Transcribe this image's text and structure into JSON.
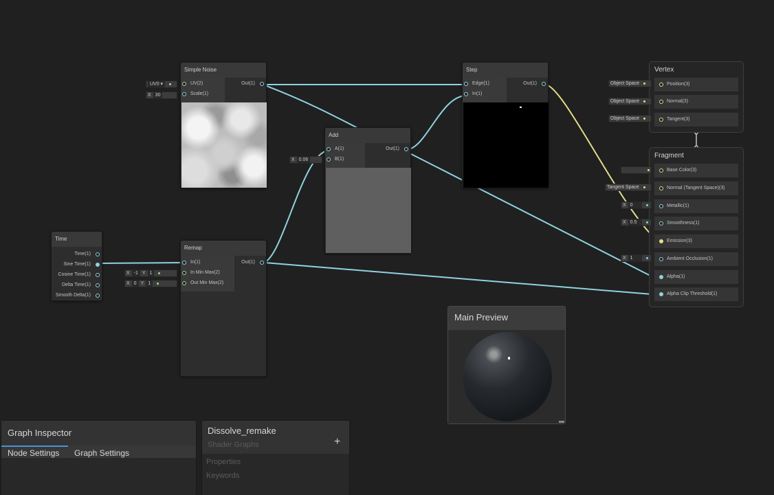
{
  "nodes": {
    "simple_noise": {
      "title": "Simple Noise",
      "in_uv": "UV(2)",
      "in_scale": "Scale(1)",
      "out": "Out(1)",
      "uv_dropdown": "UV0 ▾",
      "scale_x_label": "X",
      "scale_value": "30"
    },
    "step": {
      "title": "Step",
      "in_edge": "Edge(1)",
      "in_in": "In(1)",
      "out": "Out(1)"
    },
    "add": {
      "title": "Add",
      "in_a": "A(1)",
      "in_b": "B(1)",
      "out": "Out(1)",
      "b_x_label": "X",
      "b_value": "0.06"
    },
    "time": {
      "title": "Time",
      "outputs": [
        "Time(1)",
        "Sine Time(1)",
        "Cosine Time(1)",
        "Delta Time(1)",
        "Smooth Delta(1)"
      ]
    },
    "remap": {
      "title": "Remap",
      "in_in": "In(1)",
      "in_minmax": "In Min Max(2)",
      "out_minmax": "Out Min Max(2)",
      "out": "Out(1)",
      "in_minmax_x": "-1",
      "in_minmax_y": "1",
      "out_minmax_x": "0",
      "out_minmax_y": "1",
      "x_label": "X",
      "y_label": "Y"
    }
  },
  "vertex": {
    "title": "Vertex",
    "rows": [
      {
        "label": "Position(3)",
        "space": "Object Space"
      },
      {
        "label": "Normal(3)",
        "space": "Object Space"
      },
      {
        "label": "Tangent(3)",
        "space": "Object Space"
      }
    ]
  },
  "fragment": {
    "title": "Fragment",
    "rows": [
      {
        "label": "Base Color(3)",
        "inline": ""
      },
      {
        "label": "Normal (Tangent Space)(3)",
        "inline": "Tangent Space"
      },
      {
        "label": "Metallic(1)",
        "inline": "0"
      },
      {
        "label": "Smoothness(1)",
        "inline": "0.5"
      },
      {
        "label": "Emission(3)",
        "inline": ""
      },
      {
        "label": "Ambient Occlusion(1)",
        "inline": "1"
      },
      {
        "label": "Alpha(1)",
        "inline": ""
      },
      {
        "label": "Alpha Clip Threshold(1)",
        "inline": ""
      }
    ],
    "x_label": "X"
  },
  "main_preview": {
    "title": "Main Preview"
  },
  "graph_inspector": {
    "title": "Graph Inspector",
    "tabs": [
      "Node Settings",
      "Graph Settings"
    ]
  },
  "blackboard": {
    "title": "Dissolve_remake",
    "subtitle": "Shader Graphs",
    "add_label": "+",
    "sections": [
      "Properties",
      "Keywords"
    ]
  },
  "colors": {
    "wire_float": "#8fd3e0",
    "wire_vector2": "#a5d98a",
    "wire_vector3": "#e3dd8a",
    "canvas_bg": "#202020",
    "tab_accent": "#4a90d9"
  }
}
